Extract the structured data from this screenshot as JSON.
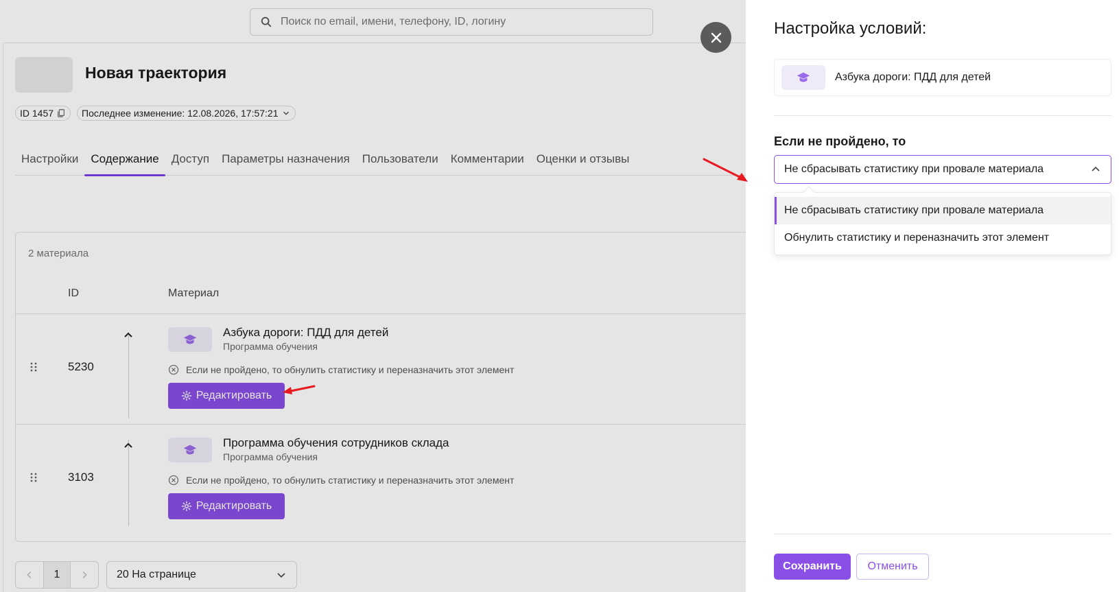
{
  "search": {
    "placeholder": "Поиск по email, имени, телефону, ID, логину"
  },
  "header": {
    "title": "Новая траектория",
    "id_label": "ID 1457",
    "last_change": "Последнее изменение: 12.08.2026, 17:57:21"
  },
  "tabs": [
    {
      "label": "Настройки"
    },
    {
      "label": "Содержание",
      "active": true
    },
    {
      "label": "Доступ"
    },
    {
      "label": "Параметры назначения"
    },
    {
      "label": "Пользователи"
    },
    {
      "label": "Комментарии"
    },
    {
      "label": "Оценки и отзывы"
    }
  ],
  "materials": {
    "count_label": "2 материала",
    "columns": {
      "id": "ID",
      "material": "Материал"
    },
    "rows": [
      {
        "id": "5230",
        "name": "Азбука дороги: ПДД для детей",
        "type": "Программа обучения",
        "condition": "Если не пройдено, то обнулить статистику и переназначить этот элемент",
        "edit_label": "Редактировать"
      },
      {
        "id": "3103",
        "name": "Программа обучения сотрудников склада",
        "type": "Программа обучения",
        "condition": "Если не пройдено, то обнулить статистику и переназначить этот элемент",
        "edit_label": "Редактировать"
      }
    ]
  },
  "pagination": {
    "current_page": "1",
    "per_page": "20 На странице"
  },
  "panel": {
    "title": "Настройка условий:",
    "material_name": "Азбука дороги: ПДД для детей",
    "field_label": "Если не пройдено, то",
    "selected_value": "Не сбрасывать статистику при провале материала",
    "options": [
      {
        "label": "Не сбрасывать статистику при провале материала",
        "selected": true
      },
      {
        "label": "Обнулить статистику и переназначить этот элемент"
      }
    ],
    "save_label": "Сохранить",
    "cancel_label": "Отменить"
  },
  "colors": {
    "accent": "#8a4fe6",
    "annotation_arrow": "#e8191f"
  },
  "icons": [
    "search-icon",
    "copy-icon",
    "chevron-down-icon",
    "close-icon",
    "drag-handle-icon",
    "chevron-up-icon",
    "graduation-cap-icon",
    "circle-x-icon",
    "gear-icon",
    "chevron-left-icon",
    "chevron-right-icon"
  ]
}
